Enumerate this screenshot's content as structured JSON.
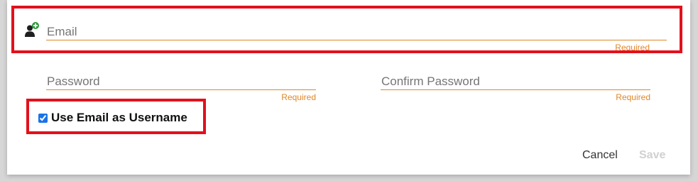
{
  "form": {
    "email": {
      "value": "",
      "placeholder": "Email",
      "hint": "Required"
    },
    "password": {
      "value": "",
      "placeholder": "Password",
      "hint": "Required"
    },
    "confirm_password": {
      "value": "",
      "placeholder": "Confirm Password",
      "hint": "Required"
    },
    "use_email_as_username": {
      "checked": true,
      "label": "Use Email as Username"
    }
  },
  "actions": {
    "cancel_label": "Cancel",
    "save_label": "Save",
    "save_enabled": false
  },
  "icons": {
    "user_add": "add-user-icon"
  },
  "colors": {
    "accent_underline": "#e0872a",
    "highlight_border": "#e3101c",
    "checkbox": "#1a73e8"
  }
}
